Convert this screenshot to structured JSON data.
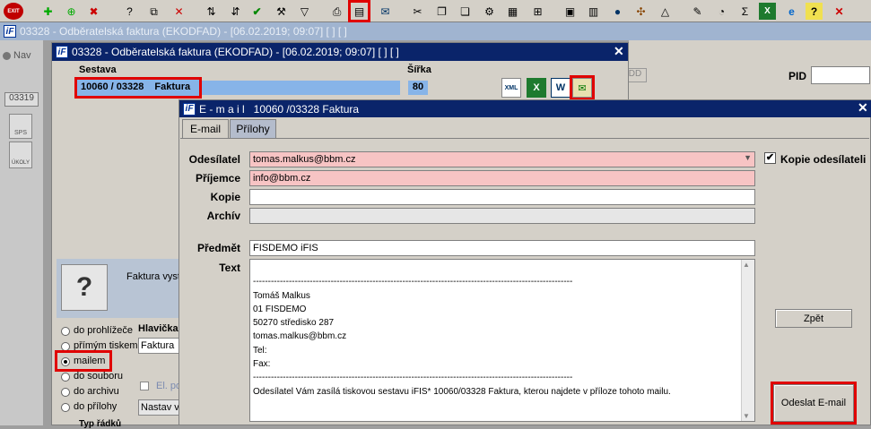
{
  "toolbar": {
    "exit_label": "EXIT",
    "icons": [
      "exit-icon",
      "add-record-icon",
      "add-copy-icon",
      "delete-record-icon",
      "help-query-icon",
      "help-copy-icon",
      "help-delete-icon",
      "sort-asc-icon",
      "sort-desc-icon",
      "check-icon",
      "wrench-icon",
      "filter-icon",
      "print-icon",
      "print-report-icon",
      "mail-icon",
      "scissors-icon",
      "copy-doc-icon",
      "paste-doc-icon",
      "columns-icon",
      "grid-icon",
      "export-icon",
      "tools-icon",
      "calendar-icon",
      "globe-icon",
      "wheel-icon",
      "triangle-icon",
      "note-icon",
      "clock-icon",
      "sigma-icon",
      "excel-icon",
      "ie-icon",
      "help-icon",
      "close-icon"
    ]
  },
  "main_title": "03328 - Odběratelská faktura (EKODFAD) - [06.02.2019; 09:07]  [ ]  [ ]",
  "leftstrip": {
    "nav": "Nav",
    "code": "03319",
    "sps": "SPS",
    "okoly": "ÚKOLY"
  },
  "inner": {
    "title": "03328 - Odběratelská faktura (EKODFAD) - [06.02.2019; 09:07]  [ ]  [ ]",
    "sestava_label": "Sestava",
    "sirka_label": "Šířka",
    "report_id": "10060 / 03328",
    "report_name": "Faktura",
    "width_value": "80",
    "faktura_text": "Faktura vysta",
    "radios": [
      {
        "label": "do prohlížeče",
        "selected": false
      },
      {
        "label": "přímým tiskem",
        "selected": false
      },
      {
        "label": "mailem",
        "selected": true
      },
      {
        "label": "do souboru",
        "selected": false
      },
      {
        "label": "do archivu",
        "selected": false
      },
      {
        "label": "do přílohy",
        "selected": false
      }
    ],
    "hlavicka_label": "Hlavička",
    "hlavicka_value": "Faktura",
    "el_label": "El. po",
    "nastav_value": "Nastav v",
    "typ_label": "Typ řádků"
  },
  "right": {
    "pid_label": "PID",
    "dd_label": "DD"
  },
  "email": {
    "title": "E - m a i l   10060 /03328 Faktura",
    "tabs": [
      "E-mail",
      "Přílohy"
    ],
    "labels": {
      "sender": "Odesílatel",
      "recipient": "Příjemce",
      "copy": "Kopie",
      "archive": "Archív",
      "subject": "Předmět",
      "text": "Text"
    },
    "sender_value": "tomas.malkus@bbm.cz",
    "recipient_value": "info@bbm.cz",
    "copy_value": "",
    "archive_value": "",
    "subject_value": "FISDEMO iFIS",
    "body_lines": [
      "",
      "-----------------------------------------------------------------------------------------------------------",
      "Tomáš Malkus",
      "01 FISDEMO",
      "50270 středisko 287",
      "tomas.malkus@bbm.cz",
      "Tel:",
      "Fax:",
      "-----------------------------------------------------------------------------------------------------------",
      "Odesílatel Vám zasílá tiskovou sestavu iFIS* 10060/03328 Faktura, kterou najdete v příloze tohoto mailu."
    ],
    "sender_copy_label": "Kopie odesílateli",
    "back_button": "Zpět",
    "send_button": "Odeslat E-mail"
  }
}
